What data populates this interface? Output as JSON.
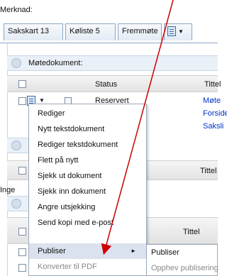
{
  "merknad_label": "Merknad:",
  "tabs": [
    {
      "label": "Sakskart",
      "count": "13"
    },
    {
      "label": "Køliste",
      "count": "5"
    },
    {
      "label": "Fremmøte",
      "count": ""
    }
  ],
  "sections": {
    "motedokument": "Møtedokument:"
  },
  "columns": {
    "status": "Status",
    "tittel": "Tittel"
  },
  "rows": [
    {
      "status": "Reservert",
      "title": "Møte"
    },
    {
      "status": "",
      "title": "Forside"
    },
    {
      "status": "",
      "title": "Saksli"
    }
  ],
  "ingen_label": "Inge",
  "context_menu": {
    "items": [
      {
        "label": "Rediger"
      },
      {
        "label": "Nytt tekstdokument"
      },
      {
        "label": "Rediger tekstdokument"
      },
      {
        "label": "Flett på nytt"
      },
      {
        "label": "Sjekk ut dokument"
      },
      {
        "label": "Sjekk inn dokument"
      },
      {
        "label": "Angre utsjekking"
      },
      {
        "label": "Send kopi med e-post"
      },
      {
        "label": "Publiser"
      },
      {
        "label": "Konverter til PDF"
      }
    ]
  },
  "submenu": {
    "items": [
      {
        "label": "Publiser"
      },
      {
        "label": "Opphev publisering"
      }
    ]
  },
  "colors": {
    "accent": "#0033cc",
    "highlight": "#d9e2ee",
    "annotation_arrow": "#cc0000"
  }
}
